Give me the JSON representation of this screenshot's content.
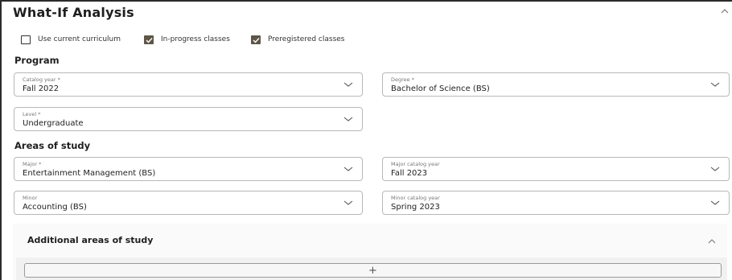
{
  "panel": {
    "title": "What-If Analysis",
    "collapse_icon": "chevron-up-icon"
  },
  "options": [
    {
      "label": "Use current curriculum",
      "checked": false
    },
    {
      "label": "In-progress classes",
      "checked": true
    },
    {
      "label": "Preregistered classes",
      "checked": true
    }
  ],
  "program": {
    "heading": "Program",
    "catalog_year": {
      "label": "Catalog year *",
      "value": "Fall 2022"
    },
    "degree": {
      "label": "Degree *",
      "value": "Bachelor of Science (BS)"
    },
    "level": {
      "label": "Level *",
      "value": "Undergraduate"
    }
  },
  "areas": {
    "heading": "Areas of study",
    "major": {
      "label": "Major *",
      "value": "Entertainment Management (BS)"
    },
    "major_catalog_year": {
      "label": "Major catalog year",
      "value": "Fall 2023"
    },
    "minor": {
      "label": "Minor",
      "value": "Accounting (BS)"
    },
    "minor_catalog_year": {
      "label": "Minor catalog year",
      "value": "Spring 2023"
    }
  },
  "additional": {
    "heading": "Additional areas of study",
    "add_label": "+"
  }
}
